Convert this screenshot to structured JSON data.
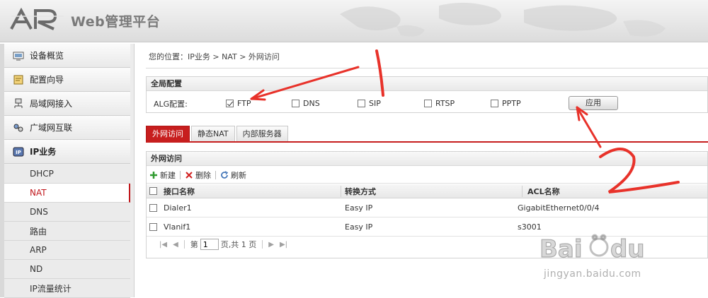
{
  "header": {
    "brand_title": "Web管理平台"
  },
  "sidebar": {
    "items": [
      {
        "label": "设备概览",
        "icon": "device-overview-icon"
      },
      {
        "label": "配置向导",
        "icon": "wizard-icon"
      },
      {
        "label": "局域网接入",
        "icon": "lan-icon"
      },
      {
        "label": "广域网互联",
        "icon": "wan-icon"
      },
      {
        "label": "IP业务",
        "icon": "ip-service-icon"
      }
    ],
    "sub_items": [
      "DHCP",
      "NAT",
      "DNS",
      "路由",
      "ARP",
      "ND",
      "IP流量统计"
    ],
    "selected_sub": "NAT"
  },
  "breadcrumb": "您的位置：IP业务 > NAT > 外网访问",
  "global_config": {
    "title": "全局配置",
    "alg_label": "ALG配置:",
    "options": [
      {
        "label": "FTP",
        "checked": true
      },
      {
        "label": "DNS",
        "checked": false
      },
      {
        "label": "SIP",
        "checked": false
      },
      {
        "label": "RTSP",
        "checked": false
      },
      {
        "label": "PPTP",
        "checked": false
      }
    ],
    "apply_label": "应用"
  },
  "tabs": [
    {
      "label": "外网访问",
      "active": true
    },
    {
      "label": "静态NAT",
      "active": false
    },
    {
      "label": "内部服务器",
      "active": false
    }
  ],
  "table_panel": {
    "title": "外网访问",
    "toolbar": {
      "new_label": "新建",
      "delete_label": "删除",
      "refresh_label": "刷新"
    },
    "columns": [
      "接口名称",
      "转换方式",
      "ACL名称"
    ],
    "rows": [
      {
        "interface": "Dialer1",
        "mode": "Easy IP",
        "acl": "GigabitEthernet0/0/4"
      },
      {
        "interface": "Vlanif1",
        "mode": "Easy IP",
        "acl": "s3001"
      }
    ],
    "pager": {
      "prefix": "第",
      "page": "1",
      "suffix": "页,共 1 页"
    }
  },
  "annotations": {
    "mark_1": "1",
    "mark_2": "2",
    "color": "#e8322a"
  },
  "watermark": {
    "domain": "jingyan.baidu.com"
  },
  "colors": {
    "accent": "#c71e1e",
    "selected_text": "#c0161b"
  }
}
